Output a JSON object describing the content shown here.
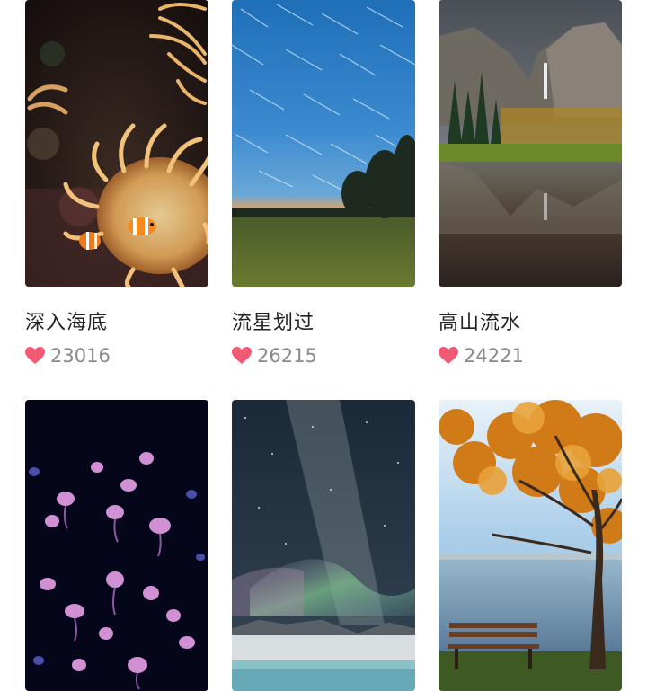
{
  "gallery": {
    "items": [
      {
        "title": "深入海底",
        "likes": "23016",
        "icon": "heart-icon",
        "scene": "anemone-clownfish"
      },
      {
        "title": "流星划过",
        "likes": "26215",
        "icon": "heart-icon",
        "scene": "star-trails"
      },
      {
        "title": "高山流水",
        "likes": "24221",
        "icon": "heart-icon",
        "scene": "mountain-lake"
      },
      {
        "title": "",
        "likes": "",
        "icon": "",
        "scene": "jellyfish"
      },
      {
        "title": "",
        "likes": "",
        "icon": "",
        "scene": "milky-way-aurora"
      },
      {
        "title": "",
        "likes": "",
        "icon": "",
        "scene": "autumn-tree-bench"
      }
    ]
  },
  "colors": {
    "heart": "#f25a74",
    "title_text": "#222222",
    "count_text": "#8a8a8a"
  }
}
